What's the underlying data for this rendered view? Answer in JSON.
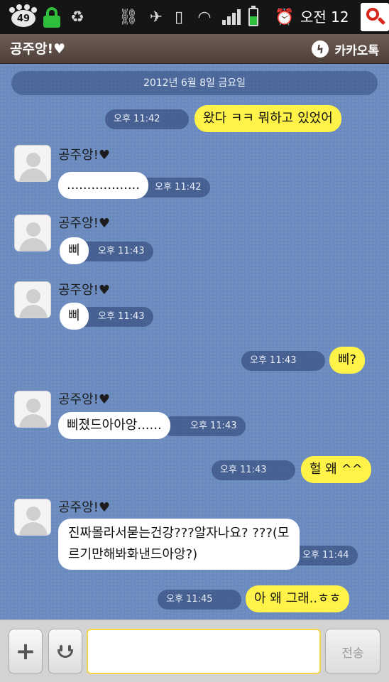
{
  "status_bar": {
    "notification_count": "49",
    "clock": "오전 12",
    "icons": [
      "paw-icon",
      "lock-icon",
      "recycle-icon",
      "usb-debug-icon",
      "mute-icon",
      "vibrate-icon",
      "wifi-icon",
      "signal-icon",
      "battery-icon",
      "alarm-icon",
      "search-icon"
    ],
    "glyphs": {
      "recycle": "♻",
      "usb": "⛓",
      "mute": "✈",
      "vibrate": "▯",
      "wifi": "◠",
      "alarm": "⏰"
    }
  },
  "header": {
    "title": "공주앙!♥",
    "brand": "카카오톡",
    "brand_icon": "bolt-icon"
  },
  "chat": {
    "date": "2012년 6월 8일 금요일",
    "messages": [
      {
        "direction": "out",
        "text": "왔다 ㅋㅋ 뭐하고 있었어",
        "time": "오후 11:42"
      },
      {
        "direction": "in",
        "sender": "공주앙!♥",
        "text": "..................",
        "time": "오후 11:42"
      },
      {
        "direction": "in",
        "sender": "공주앙!♥",
        "text": "삐",
        "time": "오후 11:43"
      },
      {
        "direction": "in",
        "sender": "공주앙!♥",
        "text": "삐",
        "time": "오후 11:43"
      },
      {
        "direction": "out",
        "text": "삐?",
        "time": "오후 11:43"
      },
      {
        "direction": "in",
        "sender": "공주앙!♥",
        "text": "삐졌드아아앙......",
        "time": "오후 11:43"
      },
      {
        "direction": "out",
        "text": "헐 왜 ^^",
        "time": "오후 11:43"
      },
      {
        "direction": "in",
        "sender": "공주앙!♥",
        "text": "진짜몰라서묻는건강???알자나요? ???(모르기만해봐화낸드아앙?)",
        "time": "오후 11:44"
      },
      {
        "direction": "out",
        "text": "아 왜 그래..ㅎㅎ",
        "time": "오후 11:45"
      }
    ]
  },
  "input_bar": {
    "plus_label": "+",
    "message_value": "",
    "send_label": "전송"
  },
  "colors": {
    "status_bar_bg": "#151515",
    "header_bg": "#5b4c45",
    "chat_bg": "#6b8bbf",
    "incoming_bubble": "#ffffff",
    "outgoing_bubble": "#fff34a",
    "input_border": "#f3d84a"
  }
}
